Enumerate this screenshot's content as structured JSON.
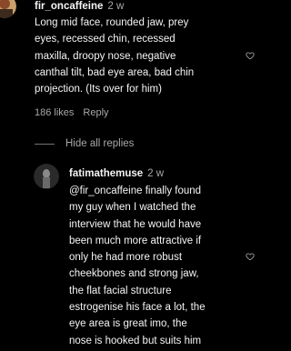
{
  "comments": [
    {
      "username": "fir_oncaffeine",
      "timestamp": "2 w",
      "text": "Long mid face, rounded jaw, prey\neyes, recessed chin, recessed\nmaxilla, droopy nose, negative\ncanthal tilt, bad eye area, bad chin\nprojection. (Its over for him)",
      "likes": "186 likes",
      "reply_label": "Reply"
    }
  ],
  "thread": {
    "hide_replies_label": "Hide all replies"
  },
  "replies": [
    {
      "username": "fatimathemuse",
      "timestamp": "2 w",
      "text": "@fir_oncaffeine finally found\nmy guy when I watched the\ninterview that he would have\nbeen much more attractive if\nonly he had more robust\ncheekbones and strong jaw,\nthe flat facial structure\nestrogenise his face a lot, the\neye area is great imo, the\nnose is hooked but suits him"
    }
  ],
  "icons": {
    "like": "heart-outline-icon"
  },
  "colors": {
    "background": "#000000",
    "text_primary": "#f5f5f5",
    "text_secondary": "#a8a8a8"
  }
}
